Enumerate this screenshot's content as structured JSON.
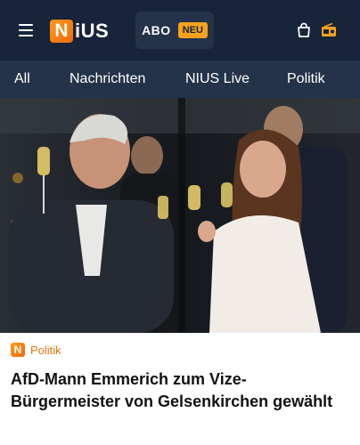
{
  "header": {
    "logo_letter": "N",
    "logo_text": "iUS",
    "abo_label": "ABO",
    "abo_badge": "NEU",
    "icons": [
      "menu-icon",
      "shopping-bag-icon",
      "radio-icon"
    ]
  },
  "nav": {
    "items": [
      {
        "label": "All"
      },
      {
        "label": "Nachrichten"
      },
      {
        "label": "NIUS Live"
      },
      {
        "label": "Politik"
      }
    ]
  },
  "article": {
    "category_logo": "N",
    "category": "Politik",
    "headline": "AfD-Mann Emmerich zum Vize-Bürgermeister von Gelsenkirchen gewählt"
  },
  "colors": {
    "header_bg": "#17243a",
    "nav_bg": "#24324a",
    "accent": "#f6a21c",
    "category": "#e07a12"
  }
}
